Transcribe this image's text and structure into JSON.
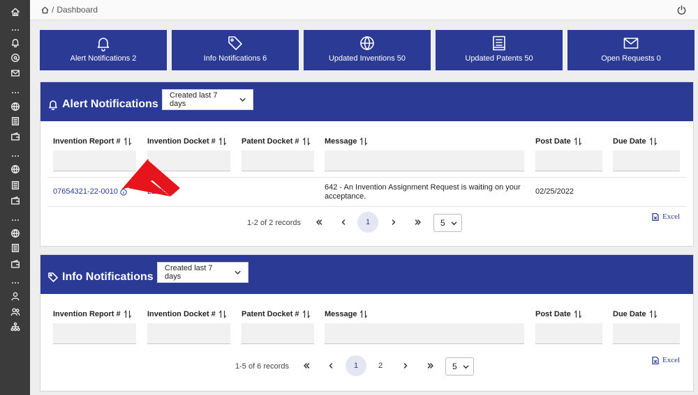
{
  "breadcrumb": {
    "current": "Dashboard",
    "separator": "/"
  },
  "sidebar": {
    "groups": [
      [
        "home-icon"
      ],
      [
        "bell-icon",
        "chat-search-icon",
        "mail-icon"
      ],
      [
        "globe-icon",
        "document-icon",
        "wallet-icon"
      ],
      [
        "globe-icon",
        "document-icon",
        "wallet-icon"
      ],
      [
        "globe-icon",
        "document-icon",
        "wallet-icon"
      ],
      [
        "user-icon",
        "users-icon",
        "org-chart-icon"
      ]
    ]
  },
  "tiles": [
    {
      "label": "Alert Notifications 2",
      "icon": "bell-icon"
    },
    {
      "label": "Info Notifications 6",
      "icon": "tag-icon"
    },
    {
      "label": "Updated Inventions 50",
      "icon": "globe-icon"
    },
    {
      "label": "Updated Patents 50",
      "icon": "book-icon"
    },
    {
      "label": "Open Requests 0",
      "icon": "mail-icon"
    }
  ],
  "alert_panel": {
    "title": "Alert Notifications",
    "period": "Created last 7 days",
    "columns": [
      "Invention Report #",
      "Invention Docket #",
      "Patent Docket #",
      "Message",
      "Post Date",
      "Due Date"
    ],
    "rows": [
      {
        "invention_report": "07654321-22-0010",
        "invention_docket": "22-0010",
        "patent_docket": "",
        "message_line1": "642 - An Invention Assignment Request is waiting on your",
        "message_line2": "acceptance.",
        "post_date": "02/25/2022",
        "due_date": ""
      }
    ],
    "records": "1-2 of 2 records",
    "pages": [
      "1"
    ],
    "page_size": "5",
    "export": "Excel"
  },
  "info_panel": {
    "title": "Info Notifications",
    "period": "Created last 7 days",
    "columns": [
      "Invention Report #",
      "Invention Docket #",
      "Patent Docket #",
      "Message",
      "Post Date",
      "Due Date"
    ],
    "records": "1-5 of 6 records",
    "pages": [
      "1",
      "2"
    ],
    "page_size": "5",
    "export": "Excel"
  },
  "colors": {
    "primary": "#2b3a94",
    "sidebar": "#3b3b3b",
    "annotation_arrow": "#e8141b"
  }
}
